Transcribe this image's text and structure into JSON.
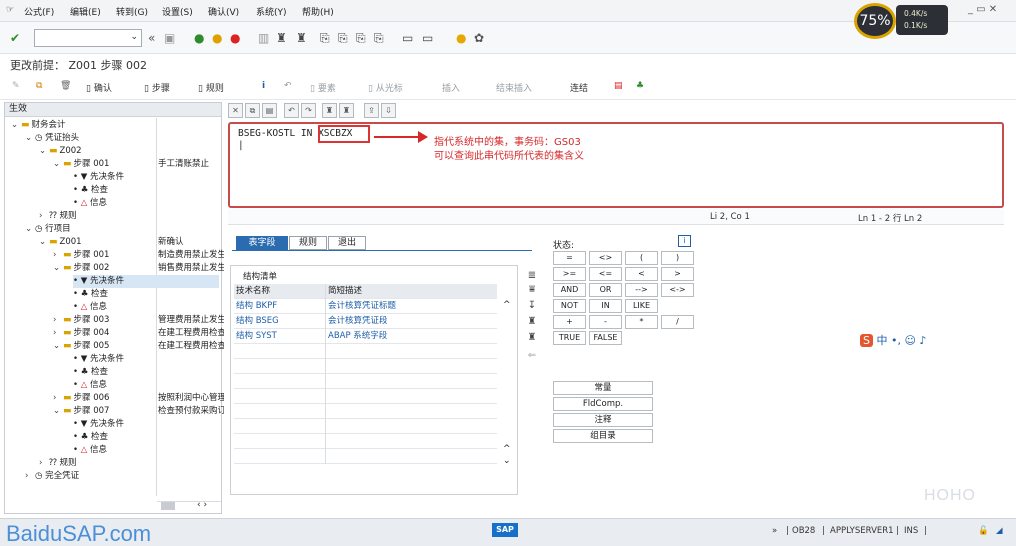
{
  "menubar": {
    "items": [
      "公式(F)",
      "编辑(E)",
      "转到(G)",
      "设置(S)",
      "确认(V)",
      "系统(Y)",
      "帮助(H)"
    ],
    "window_controls": "_ ▭ ✕"
  },
  "title": "更改前提： Z001 步骤 002",
  "app_toolbar": {
    "confirm": "确认",
    "step": "步骤",
    "rule": "规则",
    "elements": "要素",
    "from_cursor": "从光标",
    "insert": "插入",
    "end_insert": "结束插入",
    "connect": "连结"
  },
  "tree": {
    "header": "生效",
    "nodes": [
      {
        "label": "财务会计",
        "desc": ""
      },
      {
        "label": "凭证抬头",
        "desc": ""
      },
      {
        "label": "Z002",
        "desc": ""
      },
      {
        "label": "步骤 001",
        "desc": "手工清账禁止"
      },
      {
        "label": "先决条件",
        "desc": ""
      },
      {
        "label": "检查",
        "desc": ""
      },
      {
        "label": "信息",
        "desc": ""
      },
      {
        "label": "规则",
        "desc": ""
      },
      {
        "label": "行项目",
        "desc": ""
      },
      {
        "label": "Z001",
        "desc": "新确认"
      },
      {
        "label": "步骤 001",
        "desc": "制造费用禁止发生"
      },
      {
        "label": "步骤 002",
        "desc": "销售费用禁止发生"
      },
      {
        "label": "先决条件",
        "desc": ""
      },
      {
        "label": "检查",
        "desc": ""
      },
      {
        "label": "信息",
        "desc": ""
      },
      {
        "label": "步骤 003",
        "desc": "管理费用禁止发生"
      },
      {
        "label": "步骤 004",
        "desc": "在建工程费用检查"
      },
      {
        "label": "步骤 005",
        "desc": "在建工程费用检查"
      },
      {
        "label": "先决条件",
        "desc": ""
      },
      {
        "label": "检查",
        "desc": ""
      },
      {
        "label": "信息",
        "desc": ""
      },
      {
        "label": "步骤 006",
        "desc": "按照利润中心管理"
      },
      {
        "label": "步骤 007",
        "desc": "检查预付款采购订单"
      },
      {
        "label": "先决条件",
        "desc": ""
      },
      {
        "label": "检查",
        "desc": ""
      },
      {
        "label": "信息",
        "desc": ""
      },
      {
        "label": "规则",
        "desc": ""
      },
      {
        "label": "完全凭证",
        "desc": ""
      }
    ]
  },
  "editor": {
    "code_prefix": "BSEG-KOSTL IN ",
    "code_set": "XSCBZX",
    "annotation_line1": "指代系统中的集，事务码：GS03",
    "annotation_line2": "可以查询此串代码所代表的集含义",
    "cursor_pos": "Li 2, Co 1",
    "line_range": "Ln 1 - 2 行 Ln 2"
  },
  "tabs": [
    "表字段",
    "规则",
    "退出"
  ],
  "fields": {
    "caption": "结构清单",
    "col_tech": "技术名称",
    "col_desc": "简短描述",
    "rows": [
      {
        "tech": "结构 BKPF",
        "desc": "会计核算凭证标题"
      },
      {
        "tech": "结构 BSEG",
        "desc": "会计核算凭证段"
      },
      {
        "tech": "结构 SYST",
        "desc": "ABAP 系统字段"
      }
    ]
  },
  "status_label": "状态:",
  "operators": [
    "=",
    "<>",
    "(",
    ")",
    ">=",
    "<=",
    "<",
    ">",
    "AND",
    "OR",
    "-->",
    "<->",
    "NOT",
    "IN",
    "LIKE",
    "",
    "+",
    "-",
    "*",
    "/",
    "TRUE",
    "FALSE"
  ],
  "buttons": [
    "常量",
    "FldComp.",
    "注释",
    "组目录"
  ],
  "footer": {
    "watermark": "BaiduSAP.com",
    "sap_logo": "SAP",
    "tcode": "OB28",
    "server": "APPLYSERVER1",
    "mode": "INS"
  },
  "overlay": {
    "cpu": "75%",
    "up": "0.4K/s",
    "down": "0.1K/s",
    "ime": "中 •, ☺ ♪",
    "brand": "HOHO"
  }
}
